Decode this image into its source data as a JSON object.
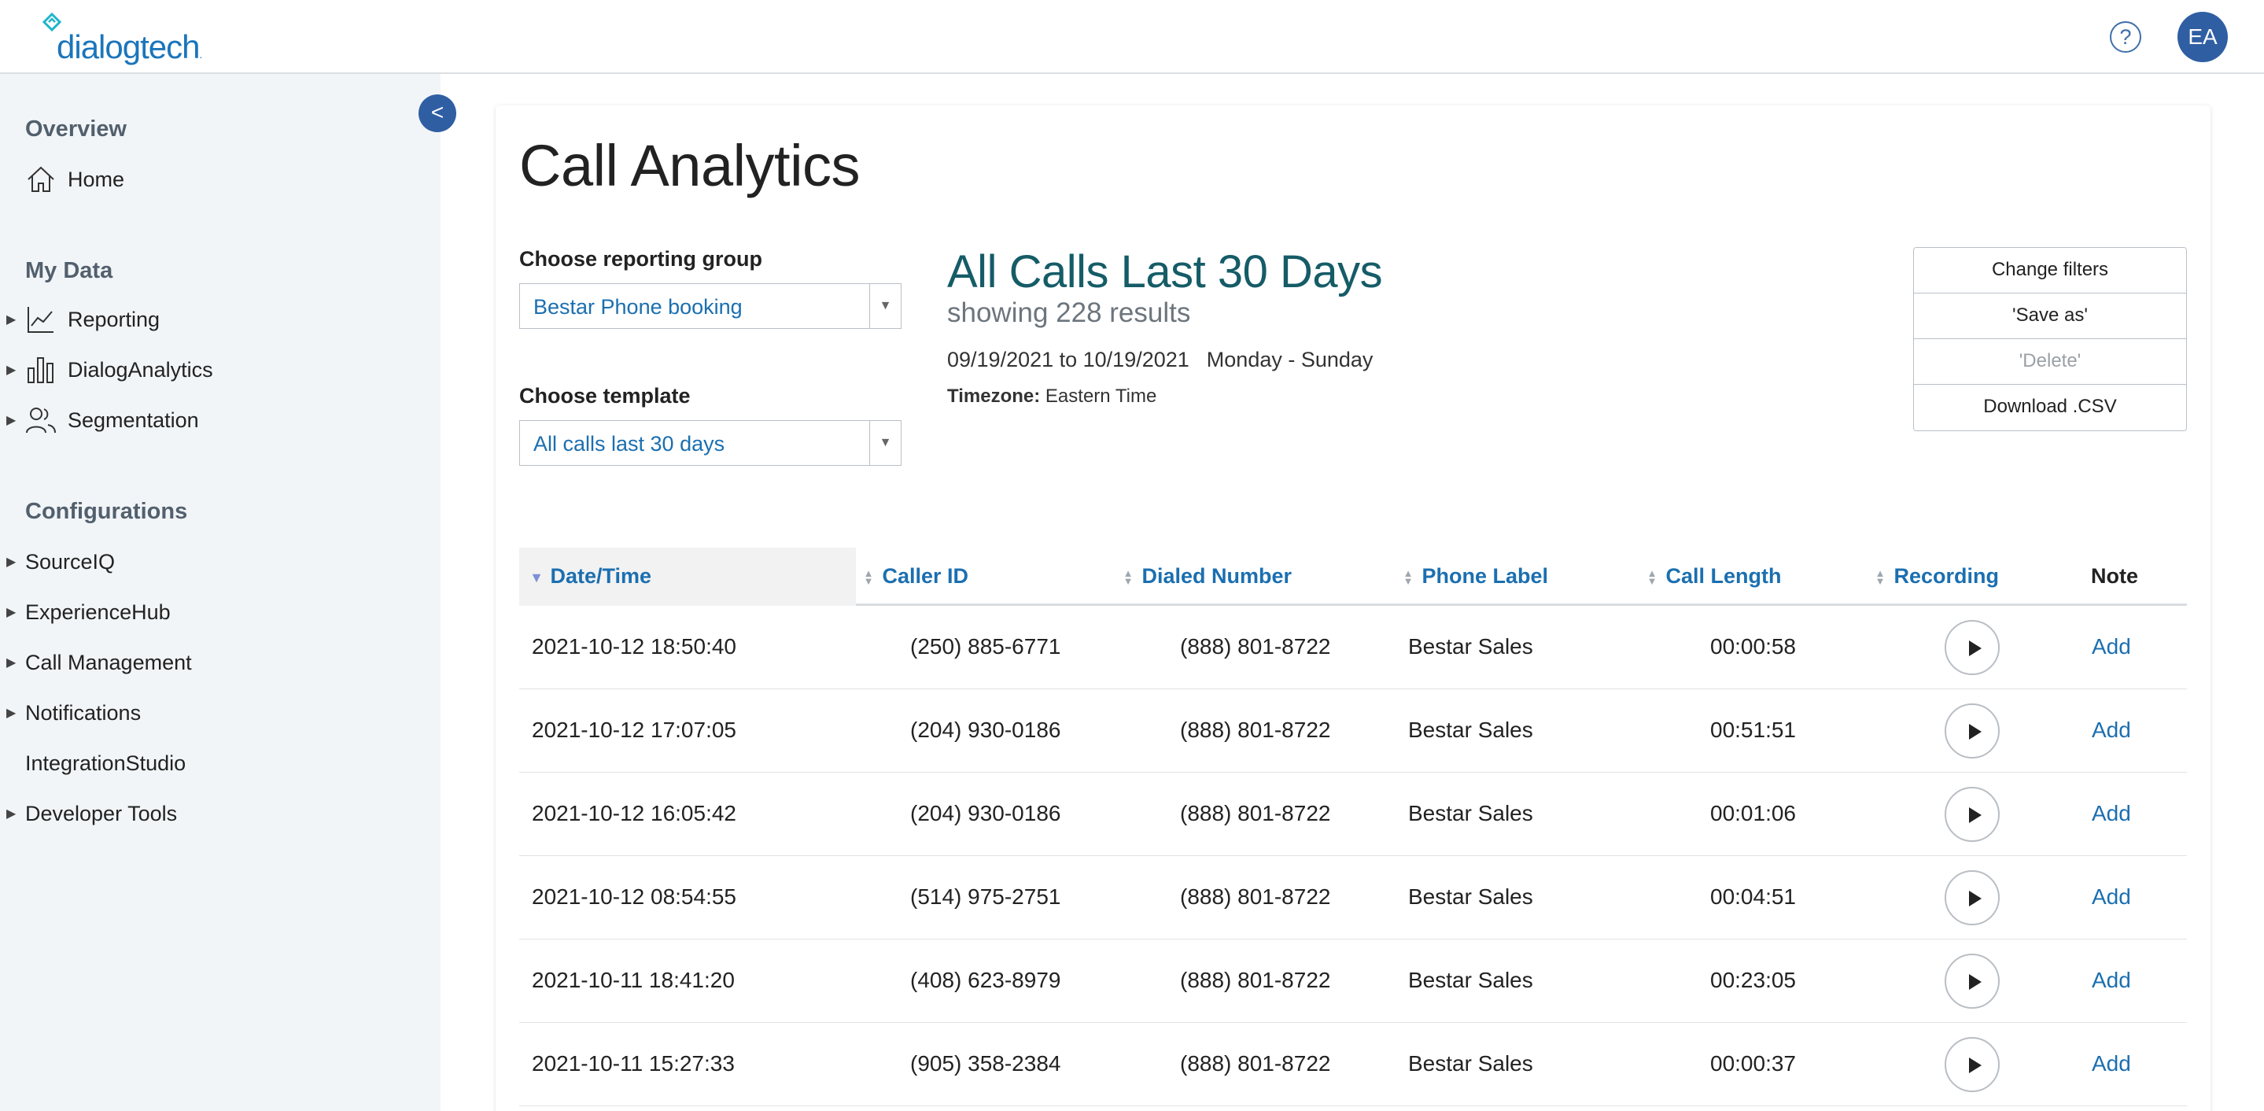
{
  "header": {
    "logo_text": "dialogtech",
    "help_label": "?",
    "avatar_initials": "EA"
  },
  "sidebar": {
    "collapse_label": "<",
    "sections": [
      {
        "title": "Overview"
      },
      {
        "title": "My Data"
      },
      {
        "title": "Configurations"
      }
    ],
    "overview_items": [
      {
        "label": "Home",
        "icon": "home-icon"
      }
    ],
    "mydata_items": [
      {
        "label": "Reporting",
        "icon": "line-chart-icon"
      },
      {
        "label": "DialogAnalytics",
        "icon": "bar-chart-icon"
      },
      {
        "label": "Segmentation",
        "icon": "users-icon"
      }
    ],
    "config_items": [
      {
        "label": "SourceIQ",
        "has_children": true
      },
      {
        "label": "ExperienceHub",
        "has_children": true
      },
      {
        "label": "Call Management",
        "has_children": true
      },
      {
        "label": "Notifications",
        "has_children": true
      },
      {
        "label": "IntegrationStudio",
        "has_children": false
      },
      {
        "label": "Developer Tools",
        "has_children": true
      }
    ]
  },
  "main": {
    "title": "Call Analytics",
    "reporting_group": {
      "label": "Choose reporting group",
      "value": "Bestar Phone booking"
    },
    "template": {
      "label": "Choose template",
      "value": "All calls last 30 days"
    },
    "report": {
      "title": "All Calls Last 30 Days",
      "count": "showing 228 results",
      "range": "09/19/2021 to 10/19/2021",
      "days": "Monday - Sunday",
      "tz_label": "Timezone:",
      "tz_value": "Eastern Time"
    },
    "actions": [
      {
        "label": "Change filters",
        "enabled": true
      },
      {
        "label": "'Save as'",
        "enabled": true
      },
      {
        "label": "'Delete'",
        "enabled": false
      },
      {
        "label": "Download .CSV",
        "enabled": true
      }
    ],
    "table": {
      "columns": [
        "Date/Time",
        "Caller ID",
        "Dialed Number",
        "Phone Label",
        "Call Length",
        "Recording",
        "Note"
      ],
      "rows": [
        {
          "datetime": "2021-10-12 18:50:40",
          "caller": "(250) 885-6771",
          "dialed": "(888) 801-8722",
          "label": "Bestar Sales",
          "length": "00:00:58",
          "note": "Add"
        },
        {
          "datetime": "2021-10-12 17:07:05",
          "caller": "(204) 930-0186",
          "dialed": "(888) 801-8722",
          "label": "Bestar Sales",
          "length": "00:51:51",
          "note": "Add"
        },
        {
          "datetime": "2021-10-12 16:05:42",
          "caller": "(204) 930-0186",
          "dialed": "(888) 801-8722",
          "label": "Bestar Sales",
          "length": "00:01:06",
          "note": "Add"
        },
        {
          "datetime": "2021-10-12 08:54:55",
          "caller": "(514) 975-2751",
          "dialed": "(888) 801-8722",
          "label": "Bestar Sales",
          "length": "00:04:51",
          "note": "Add"
        },
        {
          "datetime": "2021-10-11 18:41:20",
          "caller": "(408) 623-8979",
          "dialed": "(888) 801-8722",
          "label": "Bestar Sales",
          "length": "00:23:05",
          "note": "Add"
        },
        {
          "datetime": "2021-10-11 15:27:33",
          "caller": "(905) 358-2384",
          "dialed": "(888) 801-8722",
          "label": "Bestar Sales",
          "length": "00:00:37",
          "note": "Add"
        }
      ]
    }
  },
  "colors": {
    "brand_blue": "#1b75bb",
    "accent_navy": "#2f5ea3",
    "link_blue": "#1b6fb0",
    "report_title_teal": "#155c67",
    "sidebar_bg": "#f2f5f8"
  }
}
